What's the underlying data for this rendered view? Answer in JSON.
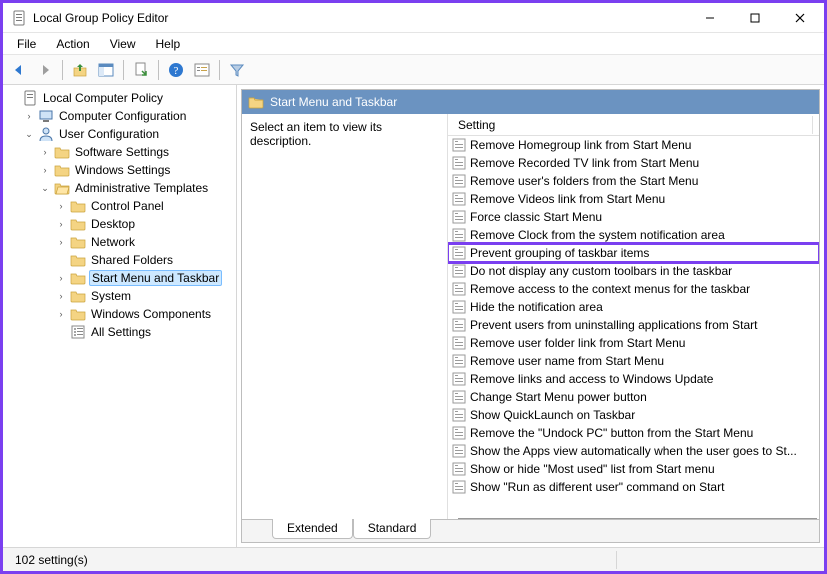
{
  "window": {
    "title": "Local Group Policy Editor"
  },
  "menubar": [
    "File",
    "Action",
    "View",
    "Help"
  ],
  "toolbar_icons": [
    "back-icon",
    "forward-icon",
    "sep",
    "up-icon",
    "show-hide-tree-icon",
    "sep",
    "export-list-icon",
    "sep",
    "help-icon",
    "properties-icon",
    "sep",
    "filter-icon"
  ],
  "tree": {
    "root": {
      "label": "Local Computer Policy",
      "icon": "policy-doc-icon",
      "expanded": true,
      "children": [
        {
          "label": "Computer Configuration",
          "icon": "computer-icon",
          "expanded": false,
          "twisty": ">"
        },
        {
          "label": "User Configuration",
          "icon": "user-icon",
          "expanded": true,
          "twisty": "v",
          "children": [
            {
              "label": "Software Settings",
              "icon": "folder-icon",
              "twisty": ">"
            },
            {
              "label": "Windows Settings",
              "icon": "folder-icon",
              "twisty": ">"
            },
            {
              "label": "Administrative Templates",
              "icon": "folder-open-icon",
              "expanded": true,
              "twisty": "v",
              "children": [
                {
                  "label": "Control Panel",
                  "icon": "folder-icon",
                  "twisty": ">"
                },
                {
                  "label": "Desktop",
                  "icon": "folder-icon",
                  "twisty": ">"
                },
                {
                  "label": "Network",
                  "icon": "folder-icon",
                  "twisty": ">"
                },
                {
                  "label": "Shared Folders",
                  "icon": "folder-icon",
                  "twisty": ""
                },
                {
                  "label": "Start Menu and Taskbar",
                  "icon": "folder-icon",
                  "twisty": ">",
                  "selected": true
                },
                {
                  "label": "System",
                  "icon": "folder-icon",
                  "twisty": ">"
                },
                {
                  "label": "Windows Components",
                  "icon": "folder-icon",
                  "twisty": ">"
                },
                {
                  "label": "All Settings",
                  "icon": "settings-list-icon",
                  "twisty": ""
                }
              ]
            }
          ]
        }
      ]
    }
  },
  "content": {
    "header_label": "Start Menu and Taskbar",
    "description_prompt": "Select an item to view its description.",
    "column_header": "Setting",
    "settings": [
      "Remove Homegroup link from Start Menu",
      "Remove Recorded TV link from Start Menu",
      "Remove user's folders from the Start Menu",
      "Remove Videos link from Start Menu",
      "Force classic Start Menu",
      "Remove Clock from the system notification area",
      "Prevent grouping of taskbar items",
      "Do not display any custom toolbars in the taskbar",
      "Remove access to the context menus for the taskbar",
      "Hide the notification area",
      "Prevent users from uninstalling applications from Start",
      "Remove user folder link from Start Menu",
      "Remove user name from Start Menu",
      "Remove links and access to Windows Update",
      "Change Start Menu power button",
      "Show QuickLaunch on Taskbar",
      "Remove the \"Undock PC\" button from the Start Menu",
      "Show the Apps view automatically when the user goes to St...",
      "Show or hide \"Most used\" list from Start menu",
      "Show \"Run as different user\" command on Start"
    ],
    "highlight_index": 6,
    "tabs": [
      "Extended",
      "Standard"
    ]
  },
  "status": {
    "text": "102 setting(s)"
  }
}
